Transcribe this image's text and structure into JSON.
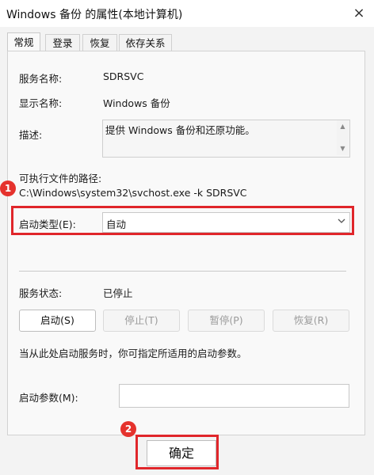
{
  "window": {
    "title": "Windows 备份 的属性(本地计算机)",
    "close_glyph": "×"
  },
  "tabs": [
    {
      "label": "常规"
    },
    {
      "label": "登录"
    },
    {
      "label": "恢复"
    },
    {
      "label": "依存关系"
    }
  ],
  "general": {
    "service_name_label": "服务名称:",
    "service_name_value": "SDRSVC",
    "display_name_label": "显示名称:",
    "display_name_value": "Windows 备份",
    "description_label": "描述:",
    "description_value": "提供 Windows 备份和还原功能。",
    "exec_path_label": "可执行文件的路径:",
    "exec_path_value": "C:\\Windows\\system32\\svchost.exe -k SDRSVC",
    "startup_type_label": "启动类型(E):",
    "startup_type_value": "自动",
    "service_status_label": "服务状态:",
    "service_status_value": "已停止",
    "buttons": {
      "start": "启动(S)",
      "stop": "停止(T)",
      "pause": "暂停(P)",
      "resume": "恢复(R)"
    },
    "hint": "当从此处启动服务时，你可指定所适用的启动参数。",
    "start_params_label": "启动参数(M):",
    "start_params_value": ""
  },
  "footer": {
    "ok_label": "确定"
  },
  "annotations": [
    {
      "number": "1"
    },
    {
      "number": "2"
    }
  ],
  "colors": {
    "highlight": "#e0262b",
    "badge": "#e5322d"
  }
}
